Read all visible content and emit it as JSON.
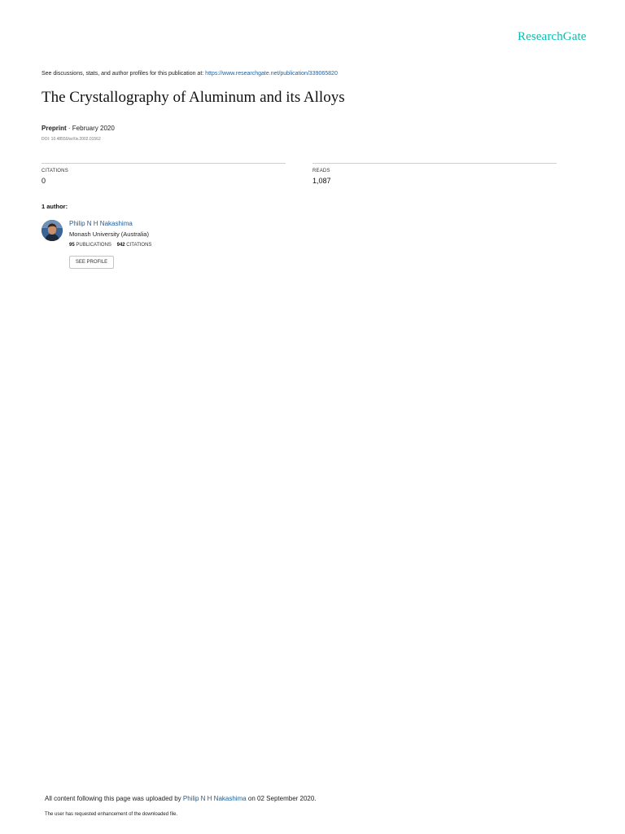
{
  "colors": {
    "brand": "#00c2b2",
    "link": "#1a5f9e"
  },
  "header": {
    "logo_text": "ResearchGate",
    "discussion_text": "See discussions, stats, and author profiles for this publication at: ",
    "publication_url": "https://www.researchgate.net/publication/339065820"
  },
  "publication": {
    "title": "The Crystallography of Aluminum and its Alloys",
    "type": "Preprint",
    "date_separator": " · ",
    "date": "February 2020",
    "doi": "DOI: 10.48550/arXiv.2002.01562"
  },
  "stats": {
    "citations_label": "CITATIONS",
    "citations_value": "0",
    "reads_label": "READS",
    "reads_value": "1,087"
  },
  "authors": {
    "heading": "1 author:",
    "list": [
      {
        "name": "Philip N H Nakashima",
        "affiliation": "Monash University (Australia)",
        "publications_count": "95",
        "publications_label": "PUBLICATIONS",
        "citations_count": "942",
        "citations_label": "CITATIONS",
        "see_profile_label": "SEE PROFILE"
      }
    ]
  },
  "footer": {
    "uploaded_prefix": "All content following this page was uploaded by ",
    "uploaded_by": "Philip N H Nakashima",
    "uploaded_suffix": " on 02 September 2020.",
    "enhancement_note": "The user has requested enhancement of the downloaded file."
  }
}
